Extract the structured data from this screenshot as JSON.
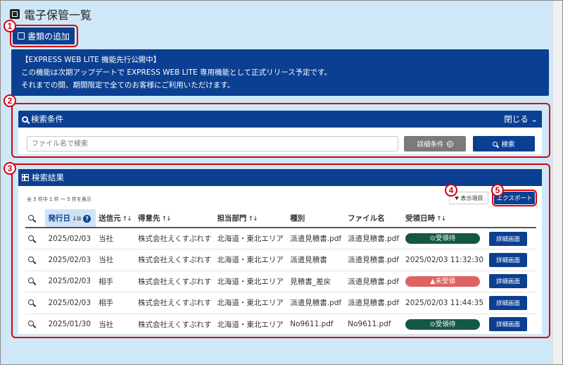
{
  "page": {
    "title": "電子保管一覧"
  },
  "toolbar": {
    "add_label": "書類の追加"
  },
  "notice": {
    "lines": [
      "【EXPRESS WEB LITE 機能先行公開中】",
      "この機能は次期アップデートで EXPRESS WEB LITE 専用機能として正式リリース予定です。",
      "それまでの間、期間限定で全てのお客様にご利用いただけます。"
    ]
  },
  "search": {
    "title": "検索条件",
    "collapse_label": "閉じる",
    "placeholder": "ファイル名で検索",
    "detail_label": "詳細条件",
    "search_label": "検索"
  },
  "results": {
    "title": "検索結果",
    "count_text": "全 5 件中 1 件 ～ 5 件を表示",
    "display_items_label": "表示項目",
    "export_label": "エクスポート",
    "columns": [
      "発行日",
      "送信元",
      "得意先",
      "担当部門",
      "種別",
      "ファイル名",
      "受領日時"
    ],
    "detail_button_label": "詳細画面",
    "rows": [
      {
        "date": "2025/02/03",
        "sender": "当社",
        "customer": "株式会社えくすぷれす",
        "dept": "北海道・東北エリア",
        "type": "派遣見積書.pdf",
        "file": "派遣見積書.pdf",
        "received": "⊙受領待",
        "status": "green"
      },
      {
        "date": "2025/02/03",
        "sender": "当社",
        "customer": "株式会社えくすぷれす",
        "dept": "北海道・東北エリア",
        "type": "派遣見積書",
        "file": "派遣見積書.pdf",
        "received": "2025/02/03 11:32:30",
        "status": ""
      },
      {
        "date": "2025/02/03",
        "sender": "相手",
        "customer": "株式会社えくすぷれす",
        "dept": "北海道・東北エリア",
        "type": "見積書_差戻",
        "file": "派遣見積書.pdf",
        "received": "▲未受領",
        "status": "red"
      },
      {
        "date": "2025/02/03",
        "sender": "相手",
        "customer": "株式会社えくすぷれす",
        "dept": "北海道・東北エリア",
        "type": "派遣見積書.pdf",
        "file": "派遣見積書.pdf",
        "received": "2025/02/03 11:44:35",
        "status": ""
      },
      {
        "date": "2025/01/30",
        "sender": "当社",
        "customer": "株式会社えくすぷれす",
        "dept": "北海道・東北エリア",
        "type": "No9611.pdf",
        "file": "No9611.pdf",
        "received": "⊙受領待",
        "status": "green"
      }
    ]
  },
  "callouts": [
    "1",
    "2",
    "3",
    "4",
    "5"
  ],
  "colors": {
    "primary": "#0b3f91",
    "background": "#cfe8f7",
    "callout": "#e00000",
    "pending": "#145844",
    "not_received": "#e06262"
  }
}
